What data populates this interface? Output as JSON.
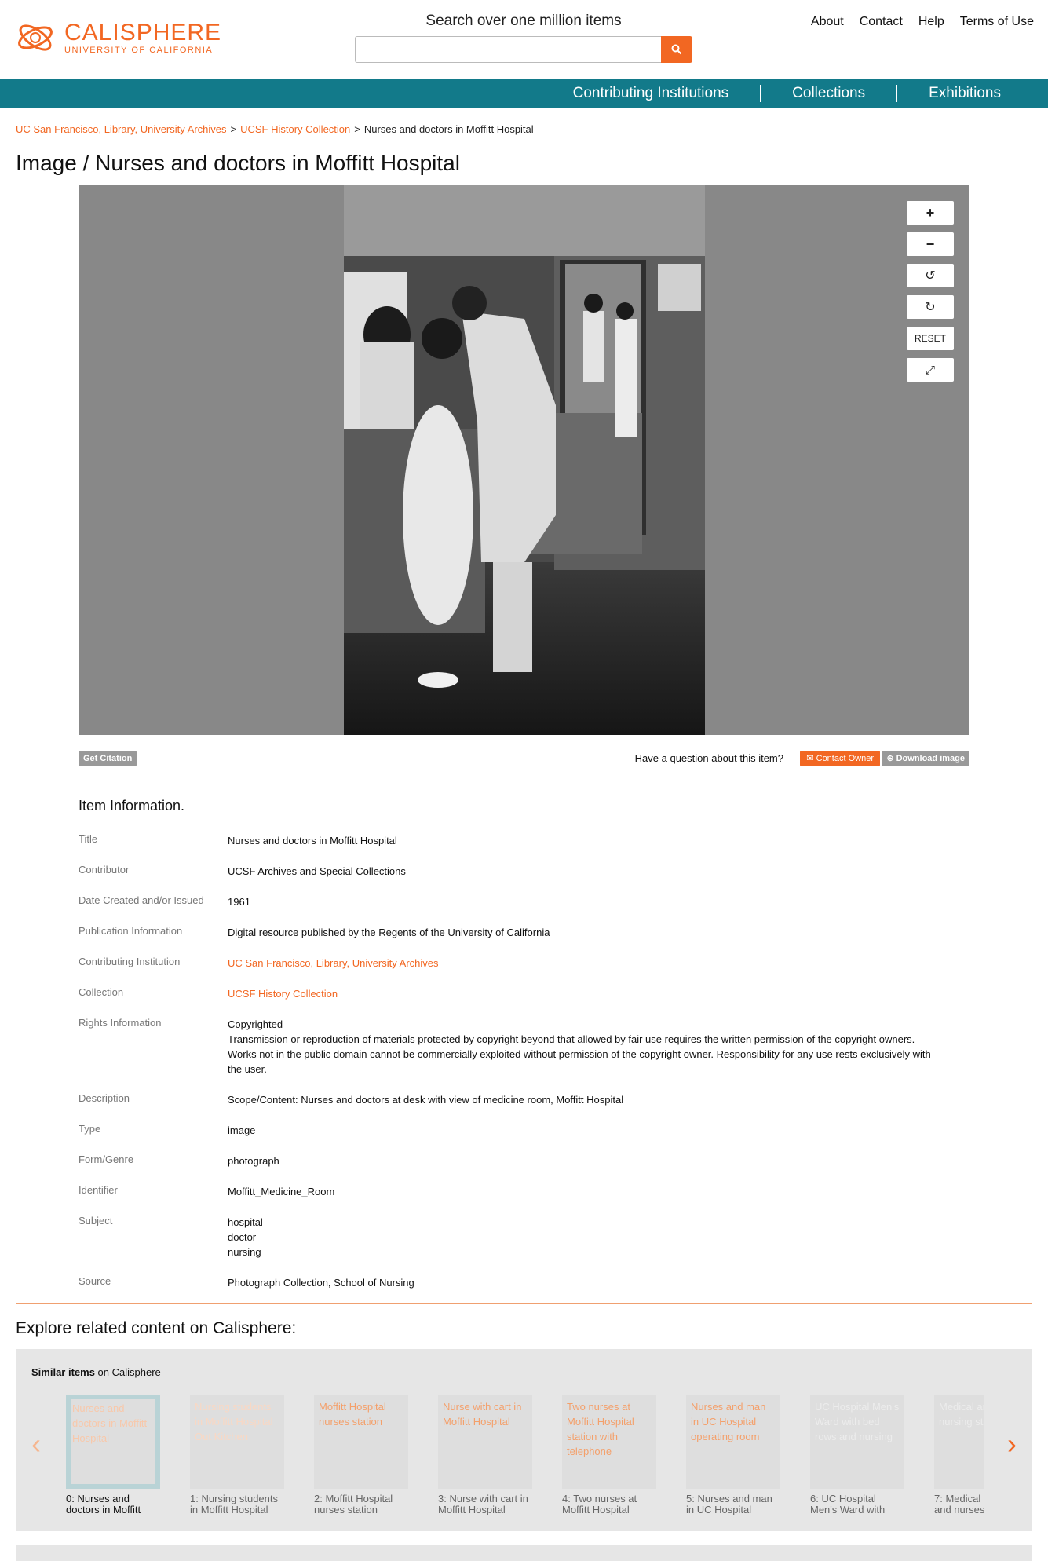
{
  "header": {
    "logo_name": "CALISPHERE",
    "logo_sub": "UNIVERSITY OF CALIFORNIA",
    "search_title": "Search over one million items",
    "search_placeholder": "",
    "links": [
      "About",
      "Contact",
      "Help",
      "Terms of Use"
    ]
  },
  "nav": [
    "Contributing Institutions",
    "Collections",
    "Exhibitions"
  ],
  "breadcrumb": {
    "institution": "UC San Francisco, Library, University Archives",
    "collection": "UCSF History Collection",
    "current": "Nurses and doctors in Moffitt Hospital",
    "sep": ">"
  },
  "title": {
    "prefix": "Image / ",
    "name": "Nurses and doctors in Moffitt Hospital"
  },
  "viewer": {
    "controls": {
      "zoom_in": "+",
      "zoom_out": "−",
      "rotate_left": "↺",
      "rotate_right": "↻",
      "reset": "RESET",
      "fullscreen": "⤢"
    }
  },
  "actions": {
    "citation": "Get Citation",
    "question": "Have a question about this item?",
    "contact_owner": "Contact Owner",
    "download": "Download image"
  },
  "item_info": {
    "heading": "Item Information.",
    "rows": [
      {
        "label": "Title",
        "value": "Nurses and doctors in Moffitt Hospital"
      },
      {
        "label": "Contributor",
        "value": "UCSF Archives and Special Collections"
      },
      {
        "label": "Date Created and/or Issued",
        "value": "1961"
      },
      {
        "label": "Publication Information",
        "value": "Digital resource published by the Regents of the University of California"
      },
      {
        "label": "Contributing Institution",
        "value": "UC San Francisco, Library, University Archives"
      },
      {
        "label": "Collection",
        "value": "UCSF History Collection"
      },
      {
        "label": "Rights Information",
        "value": "Copyrighted",
        "value2": "Transmission or reproduction of materials protected by copyright beyond that allowed by fair use requires the written permission of the copyright owners. Works not in the public domain cannot be commercially exploited without permission of the copyright owner. Responsibility for any use rests exclusively with the user."
      },
      {
        "label": "Description",
        "value": "Scope/Content: Nurses and doctors at desk with view of medicine room, Moffitt Hospital"
      },
      {
        "label": "Type",
        "value": "image"
      },
      {
        "label": "Form/Genre",
        "value": "photograph"
      },
      {
        "label": "Identifier",
        "value": "Moffitt_Medicine_Room"
      },
      {
        "label": "Subject",
        "value": "hospital",
        "value2": "doctor",
        "value3": "nursing"
      },
      {
        "label": "Source",
        "value": "Photograph Collection, School of Nursing"
      }
    ]
  },
  "related": {
    "heading": "Explore related content on Calisphere:",
    "similar_bold": "Similar items",
    "similar_rest": " on Calisphere",
    "prev_arrow": "‹",
    "next_arrow": "›",
    "thumbs": [
      {
        "alt": "Nurses and doctors in Moffitt Hospital",
        "cap1": "0: Nurses and",
        "cap2": "doctors in Moffitt"
      },
      {
        "alt": "Nursing students in Moffitt Hospital Out Kitchen",
        "cap1": "1: Nursing students",
        "cap2": "in Moffitt Hospital"
      },
      {
        "alt": "Moffitt Hospital nurses station",
        "cap1": "2: Moffitt Hospital",
        "cap2": "nurses station"
      },
      {
        "alt": "Nurse with cart in Moffitt Hospital",
        "cap1": "3: Nurse with cart in",
        "cap2": "Moffitt Hospital"
      },
      {
        "alt": "Two nurses at Moffitt Hospital station with telephone",
        "cap1": "4: Two nurses at",
        "cap2": "Moffitt Hospital"
      },
      {
        "alt": "Nurses and man in UC Hospital operating room",
        "cap1": "5: Nurses and man",
        "cap2": "in UC Hospital"
      },
      {
        "alt": "UC Hospital Men's Ward with bed rows and nursing",
        "cap1": "6: UC Hospital",
        "cap2": "Men's Ward with"
      },
      {
        "alt": "Medical and nursing staff at",
        "cap1": "7: Medical",
        "cap2": "and nurses"
      }
    ]
  },
  "colors": {
    "accent": "#f26722",
    "nav_bg": "#127a8a",
    "viewer_bg": "#888888",
    "panel_bg": "#e6e6e6"
  }
}
